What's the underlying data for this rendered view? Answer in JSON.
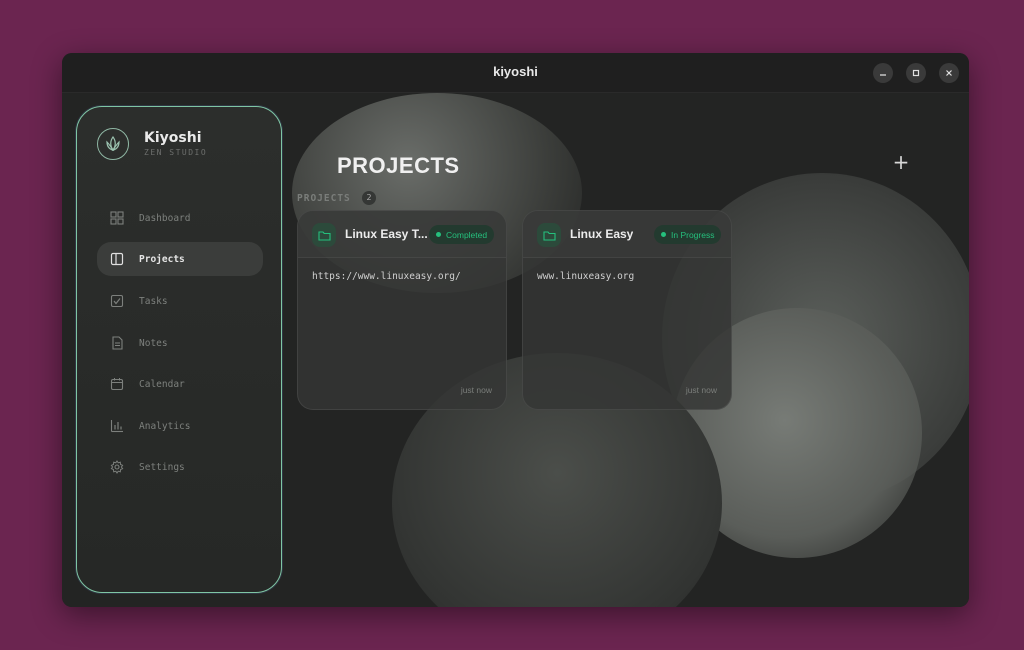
{
  "window": {
    "title": "kiyoshi"
  },
  "brand": {
    "name": "Kiyoshi",
    "subtitle": "ZEN STUDIO"
  },
  "sidebar": {
    "items": [
      {
        "label": "Dashboard",
        "icon": "dashboard-icon"
      },
      {
        "label": "Projects",
        "icon": "projects-icon",
        "active": true
      },
      {
        "label": "Tasks",
        "icon": "tasks-icon"
      },
      {
        "label": "Notes",
        "icon": "notes-icon"
      },
      {
        "label": "Calendar",
        "icon": "calendar-icon"
      },
      {
        "label": "Analytics",
        "icon": "analytics-icon"
      },
      {
        "label": "Settings",
        "icon": "settings-icon"
      }
    ]
  },
  "main": {
    "title": "PROJECTS",
    "add_label": "+",
    "section_label": "PROJECTS",
    "section_count": "2",
    "projects": [
      {
        "title": "Linux Easy T...",
        "status": "Completed",
        "url": "https://www.linuxeasy.org/",
        "time": "just now"
      },
      {
        "title": "Linux Easy",
        "status": "In Progress",
        "url": "www.linuxeasy.org",
        "time": "just now"
      }
    ]
  },
  "colors": {
    "accent": "#25c07d",
    "window_bg": "#6b2550",
    "sidebar_border": "#7fc6a4"
  }
}
